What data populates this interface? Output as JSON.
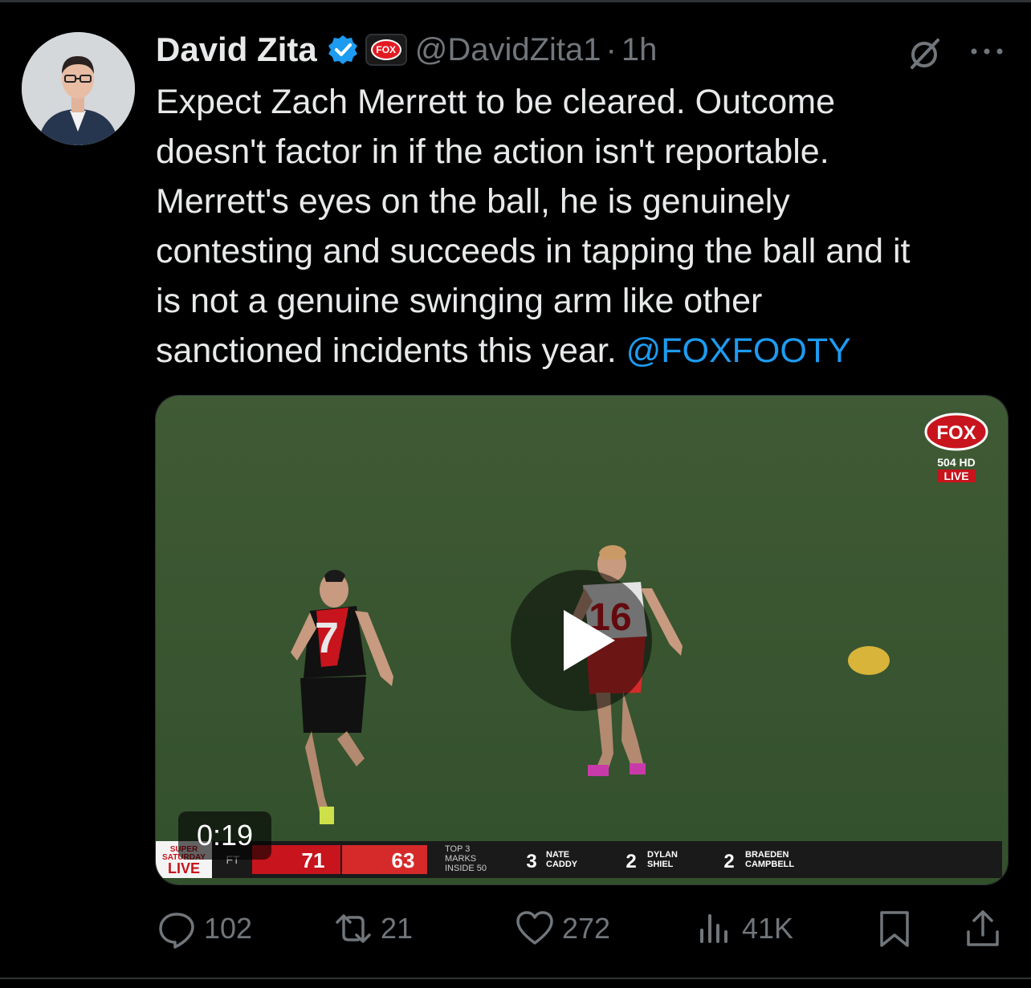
{
  "author": {
    "name": "David Zita",
    "handle": "@DavidZita1",
    "separator": "·",
    "time": "1h",
    "affiliate_badge_text": "FOX"
  },
  "tweet": {
    "text": "Expect Zach Merrett to be cleared. Outcome\ndoesn't factor in if the action isn't reportable.\nMerrett's eyes on the ball, he is genuinely\ncontesting and succeeds in tapping the ball and it\nis not a genuine swinging arm like other\nsanctioned incidents this year. ",
    "mention": "@FOXFOOTY"
  },
  "video": {
    "duration": "0:19",
    "broadcast": {
      "channel_logo": "FOX",
      "channel_number": "504 HD",
      "live_label": "LIVE",
      "program_lines": [
        "SUPER",
        "SATURDAY",
        "LIVE"
      ],
      "status": "FT",
      "home_score": "71",
      "away_score": "63",
      "stat_title_lines": [
        "TOP 3",
        "MARKS",
        "INSIDE 50"
      ],
      "leaders": [
        {
          "count": "3",
          "first": "NATE",
          "last": "CADDY"
        },
        {
          "count": "2",
          "first": "DYLAN",
          "last": "SHIEL"
        },
        {
          "count": "2",
          "first": "BRAEDEN",
          "last": "CAMPBELL"
        }
      ],
      "jersey_left": "7",
      "jersey_right": "16"
    }
  },
  "metrics": {
    "replies": "102",
    "retweets": "21",
    "likes": "272",
    "views": "41K"
  },
  "colors": {
    "background": "#000000",
    "text": "#e7e9ea",
    "muted": "#71767b",
    "accent": "#1d9bf0"
  }
}
